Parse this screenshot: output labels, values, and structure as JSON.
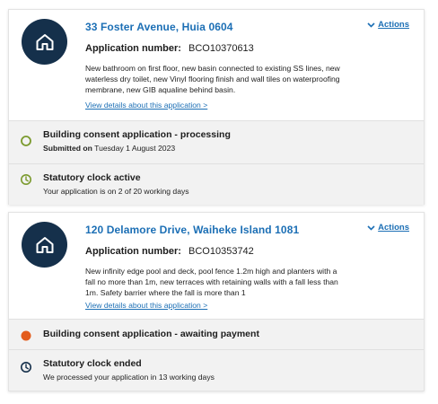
{
  "colors": {
    "accent": "#1c6fb5",
    "badge": "#15304b",
    "processing": "#7b9a2e",
    "awaiting": "#e35b1b",
    "clock_active": "#7b9a2e",
    "clock_ended": "#15304b",
    "row_bg": "#f2f2f2"
  },
  "applications": [
    {
      "icon": "house-icon",
      "address": "33 Foster Avenue, Huia 0604",
      "actions_label": "Actions",
      "app_number_label": "Application number:",
      "app_number": "BCO10370613",
      "description": "New bathroom on first floor, new basin connected to existing SS lines, new waterless dry toilet, new Vinyl flooring finish and wall tiles on waterproofing membrane, new GIB aqualine behind basin.",
      "details_link": "View details about this application >",
      "status": {
        "icon": "status-ring-icon",
        "title": "Building consent application - processing",
        "submitted_label": "Submitted on",
        "submitted_date": "Tuesday 1 August 2023"
      },
      "clock": {
        "icon": "clock-icon",
        "title": "Statutory clock active",
        "text": "Your application is on 2 of 20 working days"
      }
    },
    {
      "icon": "house-icon",
      "address": "120 Delamore Drive, Waiheke Island 1081",
      "actions_label": "Actions",
      "app_number_label": "Application number:",
      "app_number": "BCO10353742",
      "description": "New infinity edge pool and deck, pool fence 1.2m high and planters with a fall no more than 1m, new terraces with retaining walls with a fall less than 1m. Safety barrier where the fall is more than 1",
      "details_link": "View details about this application >",
      "status": {
        "icon": "status-dot-icon",
        "title": "Building consent application - awaiting payment"
      },
      "clock": {
        "icon": "clock-icon",
        "title": "Statutory clock ended",
        "text": "We processed your application in 13 working days"
      }
    }
  ]
}
